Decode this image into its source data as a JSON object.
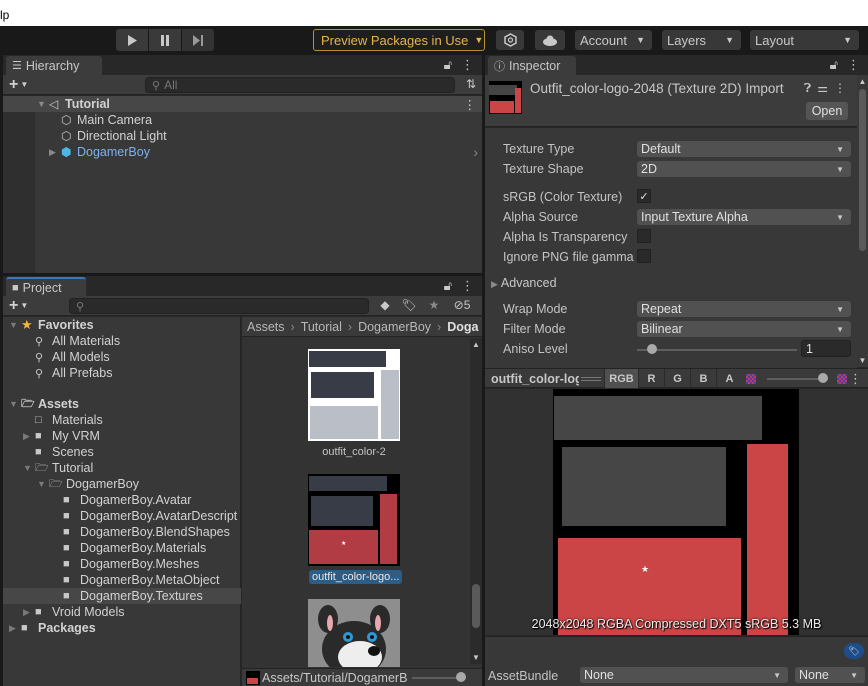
{
  "menubar": {
    "partial_item": "lp"
  },
  "toolbar": {
    "play_icon": "play-icon",
    "pause_icon": "pause-icon",
    "step_icon": "step-icon",
    "preview_packages": "Preview Packages in Use",
    "collab_icon": "collab-icon",
    "cloud_icon": "cloud-icon",
    "account": "Account",
    "layers": "Layers",
    "layout": "Layout",
    "accent_color": "#e8b54a"
  },
  "hierarchy": {
    "tab_label": "Hierarchy",
    "search_placeholder": "All",
    "scene": "Tutorial",
    "items": [
      {
        "label": "Main Camera",
        "type": "gameobject"
      },
      {
        "label": "Directional Light",
        "type": "gameobject"
      },
      {
        "label": "DogamerBoy",
        "type": "prefab",
        "expandable": true
      }
    ]
  },
  "project": {
    "tab_label": "Project",
    "search_placeholder": "",
    "hidden_packages_count": "5",
    "favorites": {
      "label": "Favorites",
      "items": [
        "All Materials",
        "All Models",
        "All Prefabs"
      ]
    },
    "assets": {
      "label": "Assets",
      "folders": [
        {
          "label": "Materials",
          "level": 1,
          "expandable": false,
          "empty": true
        },
        {
          "label": "My VRM",
          "level": 1,
          "expandable": true
        },
        {
          "label": "Scenes",
          "level": 1,
          "expandable": false
        },
        {
          "label": "Tutorial",
          "level": 1,
          "expanded": true
        },
        {
          "label": "DogamerBoy",
          "level": 2,
          "expanded": true
        },
        {
          "label": "DogamerBoy.Avatar",
          "level": 3
        },
        {
          "label": "DogamerBoy.AvatarDescript",
          "level": 3
        },
        {
          "label": "DogamerBoy.BlendShapes",
          "level": 3
        },
        {
          "label": "DogamerBoy.Materials",
          "level": 3
        },
        {
          "label": "DogamerBoy.Meshes",
          "level": 3
        },
        {
          "label": "DogamerBoy.MetaObject",
          "level": 3
        },
        {
          "label": "DogamerBoy.Textures",
          "level": 3,
          "selected": true
        },
        {
          "label": "Vroid Models",
          "level": 1,
          "expandable": true
        }
      ]
    },
    "packages": "Packages",
    "breadcrumb": [
      "Assets",
      "Tutorial",
      "DogamerBoy",
      "Doga"
    ],
    "grid_items": [
      {
        "label": "outfit_color-2",
        "selected": false
      },
      {
        "label": "outfit_color-logo...",
        "selected": true
      },
      {
        "label": "",
        "selected": false
      }
    ],
    "footer_path": "Assets/Tutorial/DogamerB"
  },
  "inspector": {
    "tab_label": "Inspector",
    "title": "Outfit_color-logo-2048 (Texture 2D) Import",
    "open_button": "Open",
    "fields": {
      "texture_type": {
        "label": "Texture Type",
        "value": "Default"
      },
      "texture_shape": {
        "label": "Texture Shape",
        "value": "2D"
      },
      "srgb": {
        "label": "sRGB (Color Texture)",
        "checked": true
      },
      "alpha_source": {
        "label": "Alpha Source",
        "value": "Input Texture Alpha"
      },
      "alpha_transparency": {
        "label": "Alpha Is Transparency",
        "checked": false
      },
      "ignore_png_gamma": {
        "label": "Ignore PNG file gamma",
        "checked": false
      },
      "advanced": {
        "label": "Advanced",
        "expanded": false
      },
      "wrap_mode": {
        "label": "Wrap Mode",
        "value": "Repeat"
      },
      "filter_mode": {
        "label": "Filter Mode",
        "value": "Bilinear"
      },
      "aniso_level": {
        "label": "Aniso Level",
        "value": "1",
        "slider_fraction": 0.06
      }
    },
    "preview": {
      "name": "outfit_color-logo",
      "channels": [
        "RGB",
        "R",
        "G",
        "B",
        "A"
      ],
      "active_channel": "RGB",
      "mip_slider_fraction": 1.0,
      "info": "2048x2048  RGBA Compressed DXT5 sRGB   5.3 MB",
      "texture_colors": {
        "red": "#cb4546",
        "gray": "#464646",
        "bg": "#000000"
      }
    },
    "asset_bundle": {
      "label": "AssetBundle",
      "value": "None",
      "variant": "None"
    }
  }
}
